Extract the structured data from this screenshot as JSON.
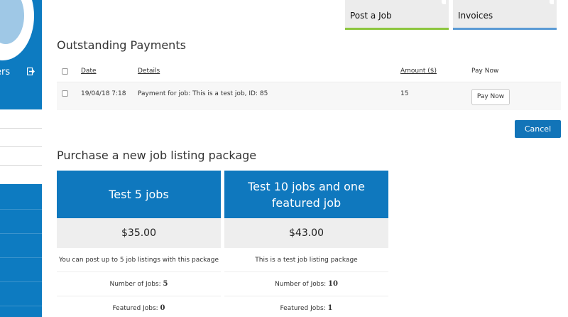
{
  "sidebar": {
    "user_label": "ers",
    "items_count_label": ""
  },
  "tiles": [
    {
      "label": "Post a Job",
      "color": "#8dc63f"
    },
    {
      "label": "Invoices",
      "color": "#5b9bd5"
    }
  ],
  "outstanding": {
    "title": "Outstanding Payments",
    "columns": {
      "date": "Date",
      "details": "Details",
      "amount": "Amount ($)",
      "pay": "Pay Now"
    },
    "rows": [
      {
        "date": "19/04/18 7:18",
        "details": "Payment for job: This is a test job, ID: 85",
        "amount": "15",
        "button": "Pay Now"
      }
    ],
    "cancel_label": "Cancel"
  },
  "packages": {
    "title": "Purchase a new job listing package",
    "items": [
      {
        "name": "Test 5 jobs",
        "price": "$35.00",
        "description": "You can post up to 5 job listings with this package",
        "jobs_label": "Number of Jobs:",
        "jobs_value": "5",
        "featured_label": "Featured Jobs:",
        "featured_value": "0"
      },
      {
        "name": "Test 10 jobs and one featured job",
        "price": "$43.00",
        "description": "This is a test job listing package",
        "jobs_label": "Number of Jobs:",
        "jobs_value": "10",
        "featured_label": "Featured Jobs:",
        "featured_value": "1"
      }
    ]
  },
  "colors": {
    "primary": "#0f78be",
    "post_job_accent": "#8dc63f",
    "invoices_accent": "#5b9bd5"
  }
}
